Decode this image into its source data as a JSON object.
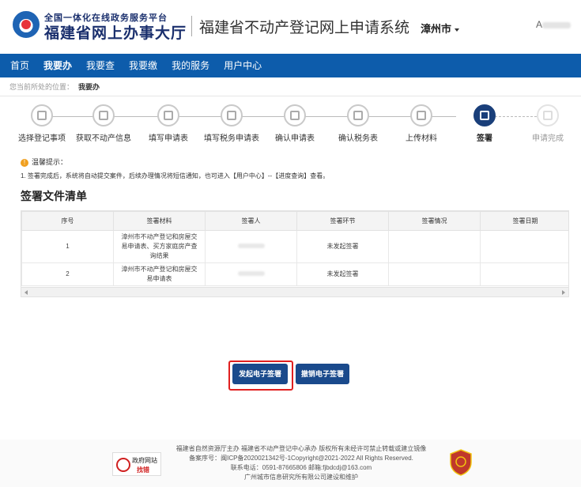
{
  "header": {
    "platform_line1": "全国一体化在线政务服务平台",
    "platform_line2": "福建省网上办事大厅",
    "system_title": "福建省不动产登记网上申请系统",
    "city": "漳州市",
    "user_glyph": "A"
  },
  "nav": {
    "items": [
      "首页",
      "我要办",
      "我要查",
      "我要缴",
      "我的服务",
      "用户中心"
    ],
    "active": "我要办"
  },
  "breadcrumb": {
    "prefix": "您当前所处的位置：",
    "current": "我要办"
  },
  "steps": [
    {
      "label": "选择登记事项",
      "state": "done",
      "icon": "list-icon"
    },
    {
      "label": "获取不动产信息",
      "state": "done",
      "icon": "building-icon"
    },
    {
      "label": "填写申请表",
      "state": "done",
      "icon": "house-icon"
    },
    {
      "label": "填写税务申请表",
      "state": "done",
      "icon": "house-icon"
    },
    {
      "label": "确认申请表",
      "state": "done",
      "icon": "house-icon"
    },
    {
      "label": "确认税务表",
      "state": "done",
      "icon": "house-icon"
    },
    {
      "label": "上传材料",
      "state": "done",
      "icon": "upload-icon"
    },
    {
      "label": "签署",
      "state": "active",
      "icon": "edit-icon"
    },
    {
      "label": "申请完成",
      "state": "future",
      "icon": "finish-icon"
    }
  ],
  "tips": {
    "title": "温馨提示：",
    "text": "1. 签署完成后，系统将自动提交案件，后续办理情况将短信通知，也可进入【用户中心】--【进度查询】查看。"
  },
  "section_title": "签署文件清单",
  "table": {
    "headers": [
      "序号",
      "签署材料",
      "签署人",
      "签署环节",
      "签署情况",
      "签署日期"
    ],
    "rows": [
      {
        "no": "1",
        "material": "漳州市不动产登记和房屋交易申请表、买方家庭房产查询结果",
        "status": "未发起签署"
      },
      {
        "no": "2",
        "material": "漳州市不动产登记和房屋交易申请表",
        "status": "未发起签署"
      }
    ]
  },
  "buttons": {
    "start": "发起电子签署",
    "revoke": "撤销电子签署"
  },
  "footer": {
    "line1": "福建省自然资源厅主办 福建省不动产登记中心承办 版权所有未经许可禁止转载或建立镜像",
    "line2": "备案序号：闽ICP备2020021342号-1Copyright@2021-2022 All Rights Reserved.",
    "line3": "联系电话：0591-87665806 邮箱:fjbdcdj@163.com",
    "line4": "广州城市信息研究所有限公司建设和维护",
    "gov_badge_1": "政府网站",
    "gov_badge_2": "找错"
  },
  "colors": {
    "nav_bg": "#0d5cab",
    "button_bg": "#1a4a8c",
    "highlight_outline": "#e02020"
  }
}
